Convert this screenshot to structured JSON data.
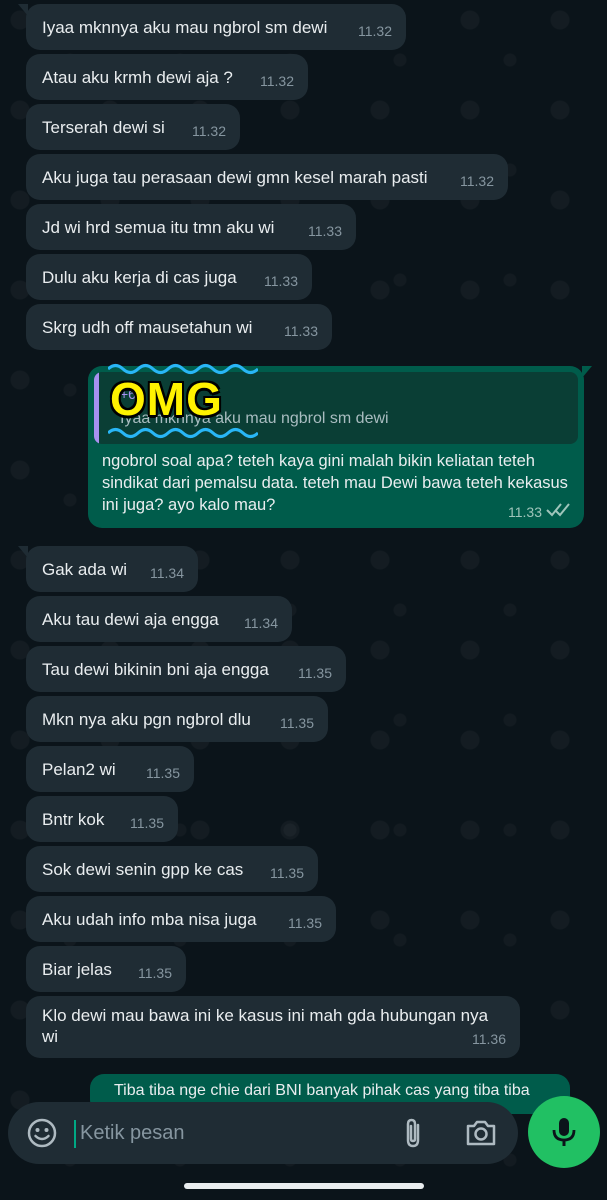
{
  "incoming_top": [
    {
      "text": "Iyaa mknnya aku mau ngbrol sm dewi",
      "time": "11.32"
    },
    {
      "text": "Atau aku krmh dewi aja ?",
      "time": "11.32"
    },
    {
      "text": "Terserah dewi si",
      "time": "11.32"
    },
    {
      "text": "Aku juga tau perasaan dewi gmn kesel marah pasti",
      "time": "11.32"
    },
    {
      "text": "Jd wi hrd semua itu tmn aku wi",
      "time": "11.33"
    },
    {
      "text": "Dulu aku kerja di cas juga",
      "time": "11.33"
    },
    {
      "text": "Skrg udh off mausetahun wi",
      "time": "11.33"
    }
  ],
  "outgoing": {
    "quote_sender": "+62",
    "quote_text": "Iyaa mknnya aku mau ngbrol sm dewi",
    "sticker_text": "OMG",
    "text": "ngobrol soal apa? teteh kaya gini malah bikin keliatan teteh sindikat dari pemalsu data. teteh mau Dewi bawa teteh kekasus ini juga? ayo kalo mau?",
    "time": "11.33"
  },
  "incoming_bottom": [
    {
      "text": "Gak ada wi",
      "time": "11.34"
    },
    {
      "text": "Aku tau dewi aja engga",
      "time": "11.34"
    },
    {
      "text": "Tau dewi bikinin bni aja engga",
      "time": "11.35"
    },
    {
      "text": "Mkn nya aku pgn ngbrol dlu",
      "time": "11.35"
    },
    {
      "text": "Pelan2 wi",
      "time": "11.35"
    },
    {
      "text": "Bntr kok",
      "time": "11.35"
    },
    {
      "text": "Sok dewi senin gpp ke cas",
      "time": "11.35"
    },
    {
      "text": "Aku udah info mba nisa juga",
      "time": "11.35"
    },
    {
      "text": "Biar jelas",
      "time": "11.35"
    }
  ],
  "last_incoming": {
    "line1": "Klo dewi mau bawa ini ke kasus ini mah gda hubungan nya",
    "line2": "wi",
    "time": "11.36"
  },
  "peek_outgoing": "Tiba tiba nge chie dari BNI banyak pihak cas yang tiba tiba",
  "composer": {
    "placeholder": "Ketik pesan"
  },
  "icons": [
    "emoji-icon",
    "attach-icon",
    "camera-icon",
    "mic-icon",
    "double-check-icon"
  ],
  "colors": {
    "incoming_bubble": "#1f2c34",
    "outgoing_bubble": "#005c4b",
    "accent": "#21c063"
  }
}
